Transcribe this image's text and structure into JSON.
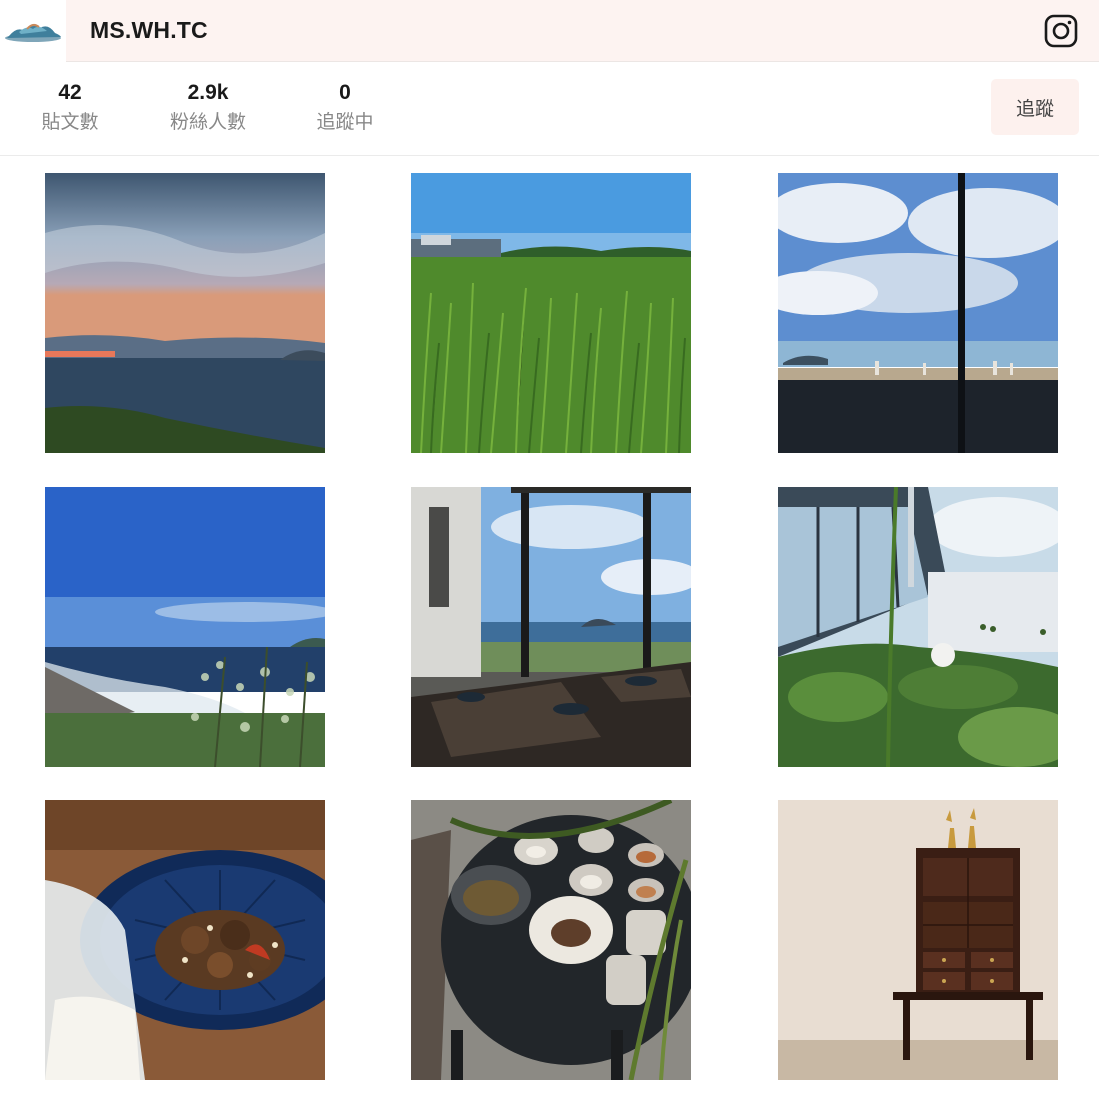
{
  "profile": {
    "username": "MS.WH.TC",
    "logo_icon": "cloud-landscape-logo-icon",
    "social_icon": "instagram-icon"
  },
  "stats": [
    {
      "value": "42",
      "label": "貼文數"
    },
    {
      "value": "2.9k",
      "label": "粉絲人數"
    },
    {
      "value": "0",
      "label": "追蹤中"
    }
  ],
  "actions": {
    "follow_label": "追蹤"
  },
  "colors": {
    "header_bg": "#fdf3f1",
    "follow_bg": "#fdf1ee",
    "label_gray": "#888888"
  },
  "posts": [
    {
      "icon": "sunset-seascape-photo"
    },
    {
      "icon": "rice-field-photo"
    },
    {
      "icon": "window-sea-view-photo"
    },
    {
      "icon": "coastline-blue-sky-photo"
    },
    {
      "icon": "restaurant-sea-view-photo"
    },
    {
      "icon": "garden-building-photo"
    },
    {
      "icon": "stir-fry-dish-photo"
    },
    {
      "icon": "tasting-plates-table-photo"
    },
    {
      "icon": "wooden-cabinet-photo"
    }
  ]
}
